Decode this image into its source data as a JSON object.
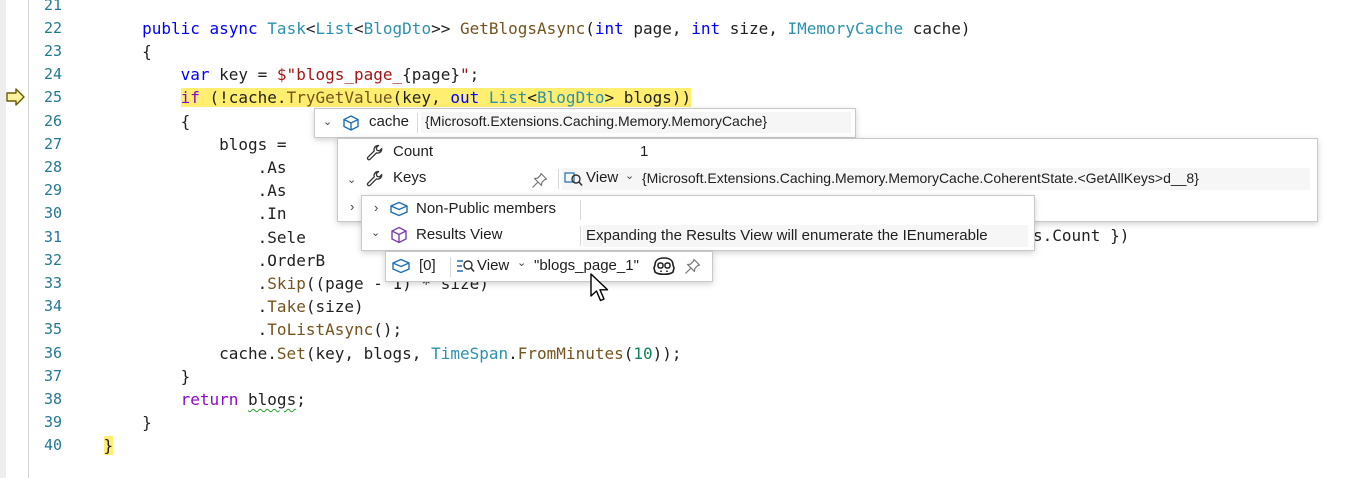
{
  "editor": {
    "lines": [
      {
        "n": "21",
        "tokens": []
      },
      {
        "n": "22",
        "indent": "        ",
        "tokens": [
          [
            "kw",
            "public "
          ],
          [
            "kw",
            "async "
          ],
          [
            "type",
            "Task"
          ],
          [
            "plain",
            "<"
          ],
          [
            "type",
            "List"
          ],
          [
            "plain",
            "<"
          ],
          [
            "type",
            "BlogDto"
          ],
          [
            "plain",
            ">> "
          ],
          [
            "meth",
            "GetBlogsAsync"
          ],
          [
            "plain",
            "("
          ],
          [
            "kw",
            "int "
          ],
          [
            "plain",
            "page, "
          ],
          [
            "kw",
            "int "
          ],
          [
            "plain",
            "size, "
          ],
          [
            "type",
            "IMemoryCache "
          ],
          [
            "plain",
            "cache)"
          ]
        ]
      },
      {
        "n": "23",
        "indent": "        ",
        "tokens": [
          [
            "plain",
            "{"
          ]
        ]
      },
      {
        "n": "24",
        "indent": "            ",
        "tokens": [
          [
            "kw",
            "var "
          ],
          [
            "plain",
            "key = "
          ],
          [
            "str",
            "$\"blogs_page_"
          ],
          [
            "plain",
            "{page}"
          ],
          [
            "str",
            "\""
          ],
          [
            "plain",
            ";"
          ]
        ]
      },
      {
        "n": "25",
        "indent": "            ",
        "highlight": true,
        "tokens": [
          [
            "ctl",
            "if "
          ],
          [
            "plain",
            "(!cache."
          ],
          [
            "meth",
            "TryGetValue"
          ],
          [
            "plain",
            "(key, "
          ],
          [
            "kw",
            "out "
          ],
          [
            "type",
            "List"
          ],
          [
            "plain",
            "<"
          ],
          [
            "type",
            "BlogDto"
          ],
          [
            "plain",
            "> blogs))"
          ]
        ]
      },
      {
        "n": "26",
        "indent": "            ",
        "tokens": [
          [
            "plain",
            "{"
          ]
        ]
      },
      {
        "n": "27",
        "indent": "                ",
        "tokens": [
          [
            "plain",
            "blogs ="
          ]
        ]
      },
      {
        "n": "28",
        "indent": "                    ",
        "tokens": [
          [
            "plain",
            ".As"
          ]
        ]
      },
      {
        "n": "29",
        "indent": "                    ",
        "tokens": [
          [
            "plain",
            ".As"
          ]
        ]
      },
      {
        "n": "30",
        "indent": "                    ",
        "tokens": [
          [
            "plain",
            ".In"
          ]
        ]
      },
      {
        "n": "31",
        "indent": "                    ",
        "tokens": [
          [
            "plain",
            ".Sele"
          ]
        ]
      },
      {
        "n": "32",
        "indent": "                    ",
        "tokens": [
          [
            "plain",
            ".OrderB"
          ]
        ]
      },
      {
        "n": "33",
        "indent": "                    ",
        "tokens": [
          [
            "plain",
            "."
          ],
          [
            "meth",
            "Skip"
          ],
          [
            "plain",
            "((page - 1) * size)"
          ]
        ]
      },
      {
        "n": "34",
        "indent": "                    ",
        "tokens": [
          [
            "plain",
            "."
          ],
          [
            "meth",
            "Take"
          ],
          [
            "plain",
            "(size)"
          ]
        ]
      },
      {
        "n": "35",
        "indent": "                    ",
        "tokens": [
          [
            "plain",
            "."
          ],
          [
            "meth",
            "ToListAsync"
          ],
          [
            "plain",
            "();"
          ]
        ]
      },
      {
        "n": "36",
        "indent": "                ",
        "tokens": [
          [
            "plain",
            "cache."
          ],
          [
            "meth",
            "Set"
          ],
          [
            "plain",
            "(key, blogs, "
          ],
          [
            "type",
            "TimeSpan"
          ],
          [
            "plain",
            "."
          ],
          [
            "meth",
            "FromMinutes"
          ],
          [
            "plain",
            "("
          ],
          [
            "num",
            "10"
          ],
          [
            "plain",
            "));"
          ]
        ]
      },
      {
        "n": "37",
        "indent": "            ",
        "tokens": [
          [
            "plain",
            "}"
          ]
        ]
      },
      {
        "n": "38",
        "indent": "            ",
        "tokens": [
          [
            "ctl",
            "return "
          ],
          [
            "squig",
            "blogs"
          ],
          [
            "plain",
            ";"
          ]
        ]
      },
      {
        "n": "39",
        "indent": "        ",
        "tokens": [
          [
            "plain",
            "}"
          ]
        ]
      },
      {
        "n": "40",
        "indent": "    ",
        "tokens": [
          [
            "hl",
            "}"
          ]
        ]
      }
    ],
    "line31_tail": "s.Count })"
  },
  "datatip": {
    "cache_name": "cache",
    "cache_value": "{Microsoft.Extensions.Caching.Memory.MemoryCache}",
    "count_name": "Count",
    "count_value": "1",
    "keys_name": "Keys",
    "keys_view": "View",
    "keys_value": "{Microsoft.Extensions.Caching.Memory.MemoryCache.CoherentState.<GetAllKeys>d__8}",
    "nonpublic_name": "Non-Public members",
    "results_name": "Results View",
    "results_value": "Expanding the Results View will enumerate the IEnumerable",
    "item_index": "[0]",
    "item_view": "View",
    "item_value": "\"blogs_page_1\""
  },
  "colors": {
    "keyword": "#0000ff",
    "control": "#8f08c4",
    "type": "#2b91af",
    "string": "#a31515",
    "method": "#74531f",
    "line_number": "#237893",
    "current_line_highlight": "#ffee6f"
  },
  "icons": [
    "execution-arrow-icon",
    "expand-chevron-icon",
    "object-icon",
    "wrench-icon",
    "pin-icon",
    "visualizer-magnifier-icon",
    "results-view-icon",
    "copilot-icon",
    "mouse-cursor-icon"
  ]
}
